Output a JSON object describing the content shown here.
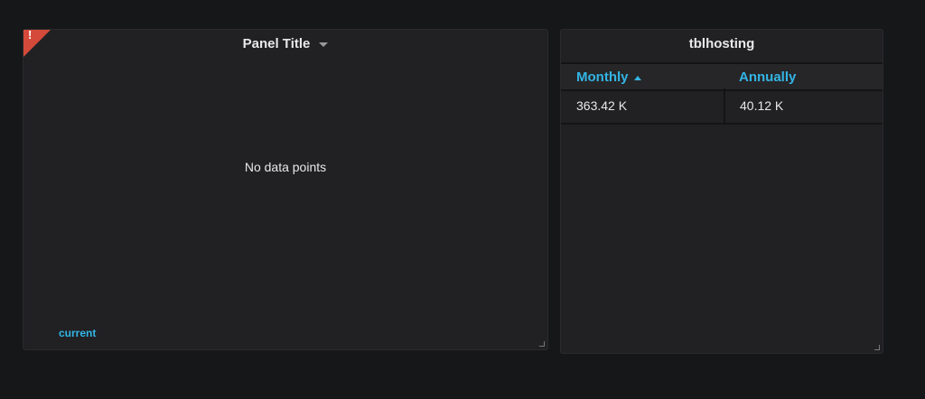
{
  "graph_panel": {
    "title": "Panel Title",
    "error_icon": "!",
    "message": "No data points",
    "legend": "current"
  },
  "table_panel": {
    "title": "tblhosting",
    "columns": [
      {
        "label": "Monthly",
        "sort": "asc"
      },
      {
        "label": "Annually"
      }
    ],
    "rows": [
      [
        "363.42 K",
        "40.12 K"
      ]
    ]
  },
  "colors": {
    "accent": "#33b5e5",
    "error": "#d44a3a"
  }
}
